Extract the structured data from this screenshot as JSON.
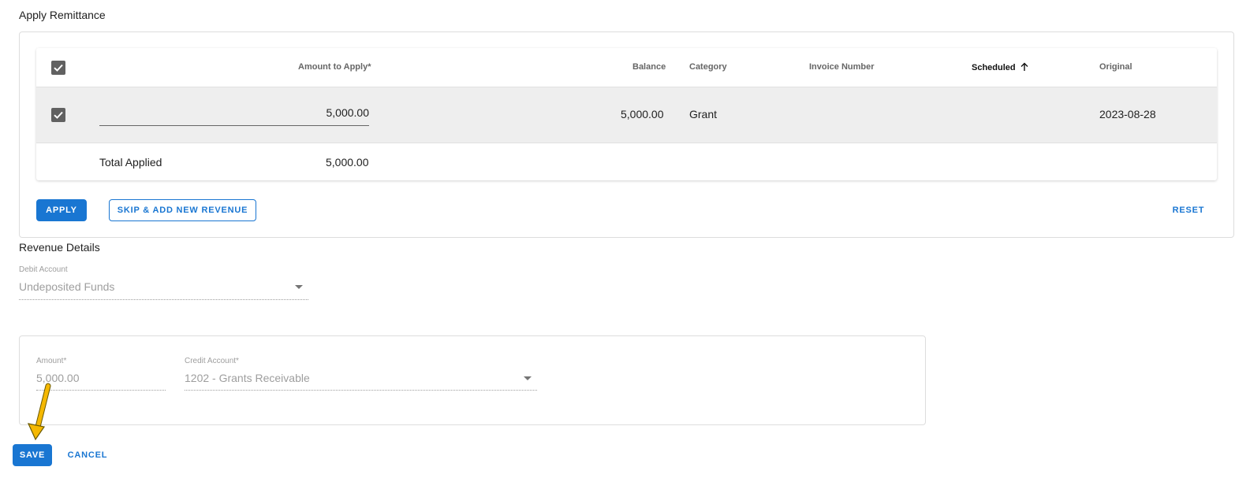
{
  "apply_remittance": {
    "title": "Apply Remittance",
    "columns": {
      "amount_to_apply": "Amount to Apply*",
      "balance": "Balance",
      "category": "Category",
      "invoice_number": "Invoice Number",
      "scheduled": "Scheduled",
      "original": "Original"
    },
    "sort_icon": "arrow-up-icon",
    "rows": [
      {
        "checked": true,
        "amount_to_apply": "5,000.00",
        "balance": "5,000.00",
        "category": "Grant",
        "invoice_number": "",
        "scheduled": "",
        "original": "2023-08-28"
      }
    ],
    "total_label": "Total Applied",
    "total_value": "5,000.00",
    "buttons": {
      "apply": "APPLY",
      "skip_add": "SKIP & ADD NEW REVENUE",
      "reset": "RESET"
    }
  },
  "revenue_details": {
    "title": "Revenue Details",
    "debit_account": {
      "label": "Debit Account",
      "value": "Undeposited Funds"
    },
    "amount": {
      "label": "Amount*",
      "value": "5,000.00"
    },
    "credit_account": {
      "label": "Credit Account*",
      "value": "1202 - Grants Receivable"
    }
  },
  "footer": {
    "save": "SAVE",
    "cancel": "CANCEL"
  },
  "colors": {
    "primary": "#1976d2",
    "annotation_arrow": "#f5b800"
  }
}
